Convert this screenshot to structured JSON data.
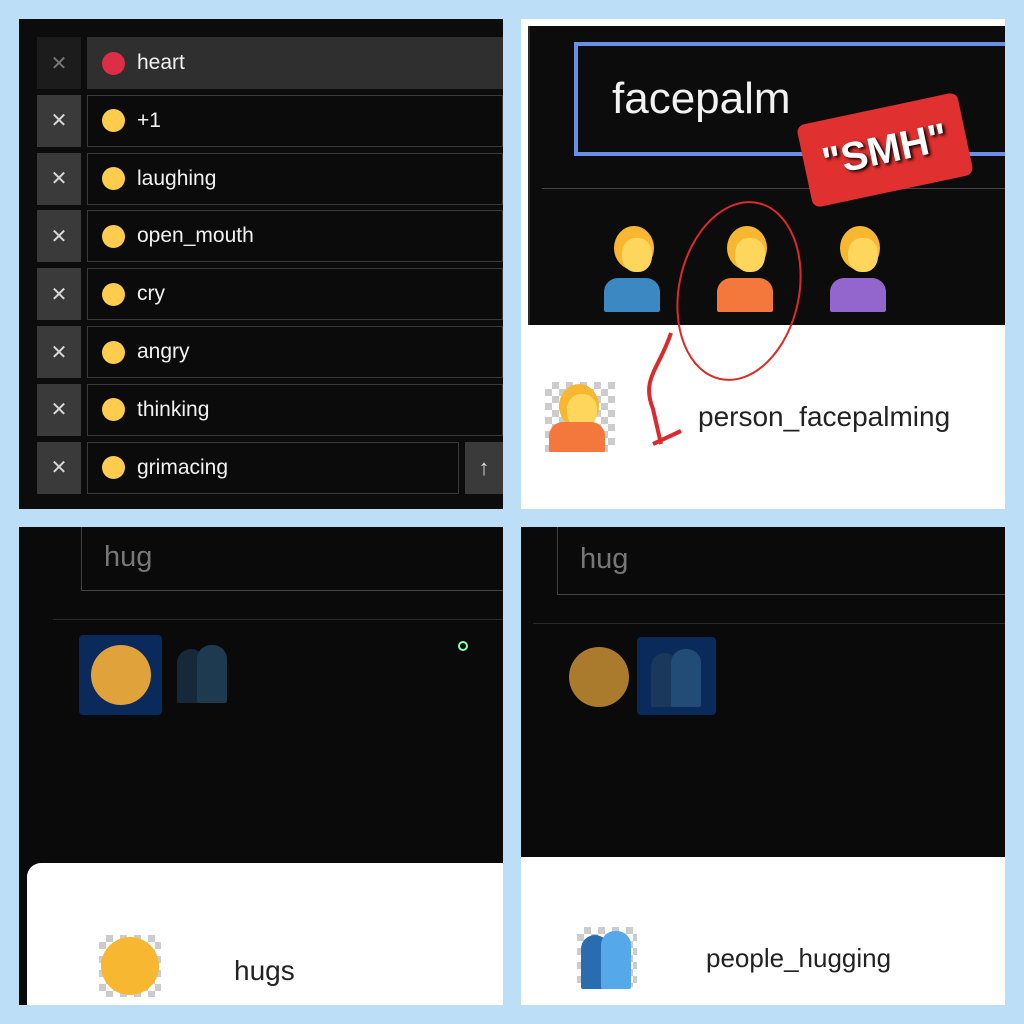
{
  "panel1": {
    "remove_label": "✕",
    "up_label": "↑",
    "items": [
      {
        "label": "heart",
        "icon": "heart-icon",
        "color": "#dd2e44"
      },
      {
        "label": "+1",
        "icon": "thumbs-up-icon",
        "color": "#ffcc4d"
      },
      {
        "label": "laughing",
        "icon": "laughing-face-icon",
        "color": "#ffcc4d"
      },
      {
        "label": "open_mouth",
        "icon": "open-mouth-face-icon",
        "color": "#ffcc4d"
      },
      {
        "label": "cry",
        "icon": "crying-face-icon",
        "color": "#ffcc4d"
      },
      {
        "label": "angry",
        "icon": "angry-face-icon",
        "color": "#ffcc4d"
      },
      {
        "label": "thinking",
        "icon": "thinking-face-icon",
        "color": "#ffcc4d"
      },
      {
        "label": "grimacing",
        "icon": "grimacing-face-icon",
        "color": "#ffcc4d"
      }
    ]
  },
  "panel2": {
    "search_value": "facepalm",
    "annotation": "\"SMH\"",
    "results": [
      {
        "color": "#3b88c3"
      },
      {
        "color": "#f4773b"
      },
      {
        "color": "#9266cc"
      }
    ],
    "selected_label": "person_facepalming",
    "accent": "#6b8ee8"
  },
  "panel3": {
    "search_value": "hug",
    "selected_label": "hugs"
  },
  "panel4": {
    "search_value": "hug",
    "selected_label": "people_hugging"
  }
}
